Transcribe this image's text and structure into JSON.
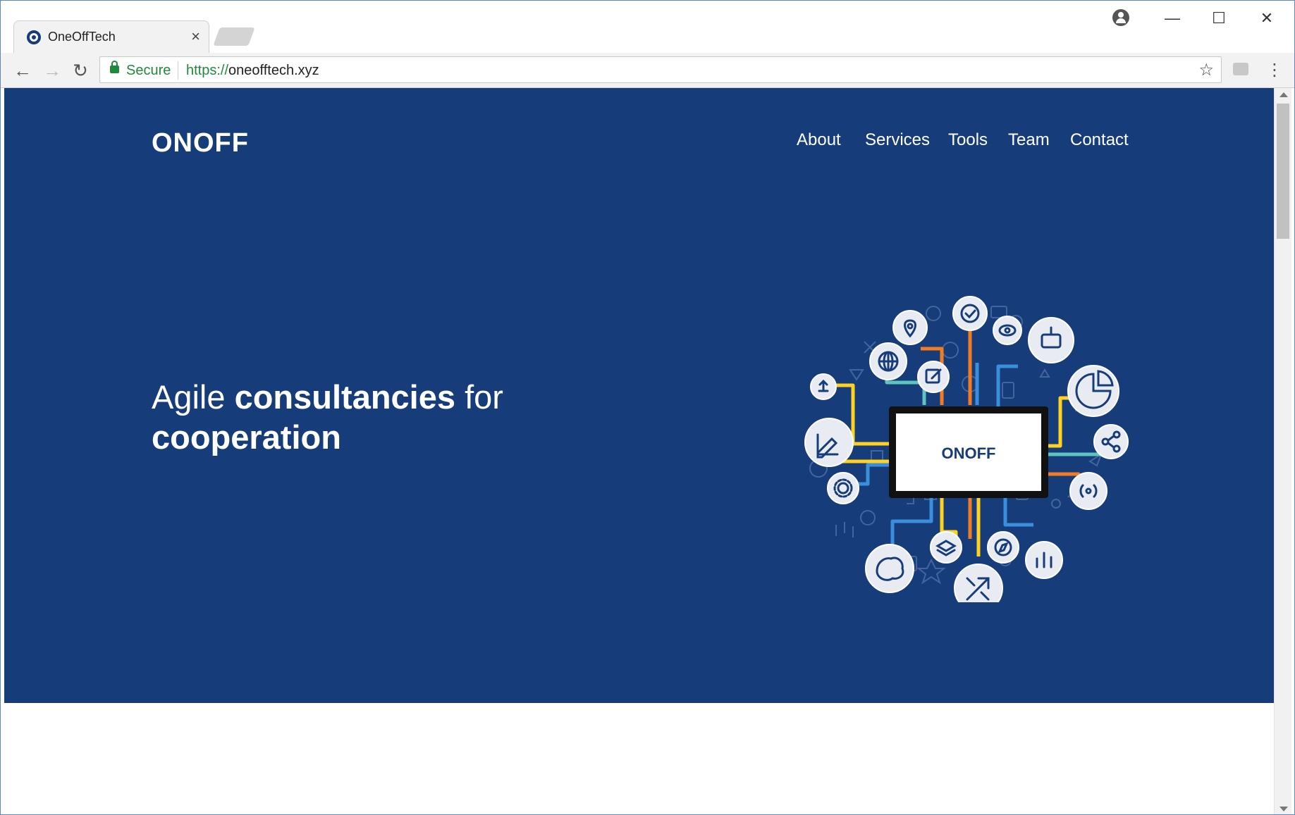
{
  "browser": {
    "tab_title": "OneOffTech",
    "tab_close": "×",
    "window_controls": {
      "minimize": "—",
      "maximize": "☐",
      "close": "✕"
    },
    "nav": {
      "back": "←",
      "forward": "→",
      "reload": "↻"
    },
    "security_label": "Secure",
    "url_scheme": "https://",
    "url_host": "oneofftech.xyz",
    "bookmark": "☆",
    "menu": "⋮",
    "icons": [
      "account-icon",
      "extension-icon",
      "lock-icon",
      "star-icon",
      "menu-icon"
    ]
  },
  "site": {
    "logo_text": "ONOFF",
    "nav": [
      "About",
      "Services",
      "Tools",
      "Team",
      "Contact"
    ],
    "hero": {
      "headline_part1": "Agile ",
      "headline_bold1": "consultancies",
      "headline_part2": " for ",
      "headline_bold2": "cooperation"
    },
    "illustration_label": "ONOFF",
    "colors": {
      "brand_blue": "#173c7a",
      "accent_orange": "#f47b20",
      "accent_yellow": "#ffd21f",
      "accent_light_blue": "#3a8fdc",
      "accent_teal": "#5cc5c0"
    }
  }
}
